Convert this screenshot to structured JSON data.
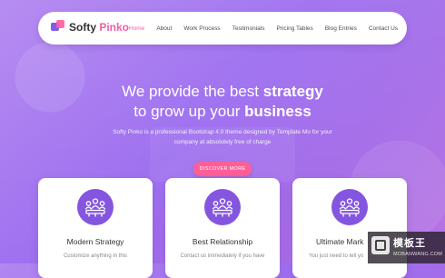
{
  "brand": {
    "name_part1": "Softy ",
    "name_part2": "Pinko",
    "accent_color": "#ef5fa4",
    "primary_color": "#8456df"
  },
  "nav": {
    "items": [
      {
        "label": "Home",
        "active": true
      },
      {
        "label": "About",
        "active": false
      },
      {
        "label": "Work Process",
        "active": false
      },
      {
        "label": "Testimonials",
        "active": false
      },
      {
        "label": "Pricing Tables",
        "active": false
      },
      {
        "label": "Blog Entries",
        "active": false
      },
      {
        "label": "Contact Us",
        "active": false
      }
    ]
  },
  "hero": {
    "line1_normal": "We provide the best ",
    "line1_bold": "strategy",
    "line2_normal": "to grow up your ",
    "line2_bold": "business",
    "subtitle_line1": "Softy Pinko is a professional Bootstrap 4.0 theme designed by Template Mo for your",
    "subtitle_line2": "company at absolutely free of charge",
    "cta_label": "DISCOVER MORE"
  },
  "cards": [
    {
      "title": "Modern Strategy",
      "text": "Customize anything in this",
      "icon": "team-icon"
    },
    {
      "title": "Best Relationship",
      "text": "Contact us immediately if you have",
      "icon": "team-icon"
    },
    {
      "title": "Ultimate Mark",
      "text": "You just need to tell yo",
      "icon": "team-icon"
    }
  ],
  "watermark": {
    "chinese_text": "模板王",
    "site": "MOBANWANG.COM"
  }
}
